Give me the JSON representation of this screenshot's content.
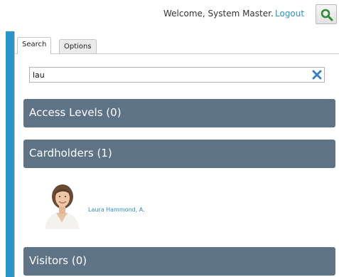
{
  "header": {
    "welcome_text": "Welcome, System Master.",
    "logout_label": "Logout",
    "search_button_icon": "magnifier-icon",
    "search_icon_color": "#2e8b3a"
  },
  "tabs": [
    {
      "label": "Search",
      "active": true
    },
    {
      "label": "Options",
      "active": false
    }
  ],
  "search": {
    "value": "lau",
    "clear_icon": "clear-x-icon",
    "clear_icon_color": "#3a7fc8"
  },
  "sections": {
    "access_levels": "Access Levels (0)",
    "cardholders": "Cardholders (1)",
    "visitors": "Visitors (0)"
  },
  "cardholders": [
    {
      "name": "Laura Hammond, A.",
      "icon": "person-photo"
    }
  ],
  "colors": {
    "accent": "#2b95c9",
    "section_header": "#5f7387",
    "link": "#2a8fc4"
  }
}
